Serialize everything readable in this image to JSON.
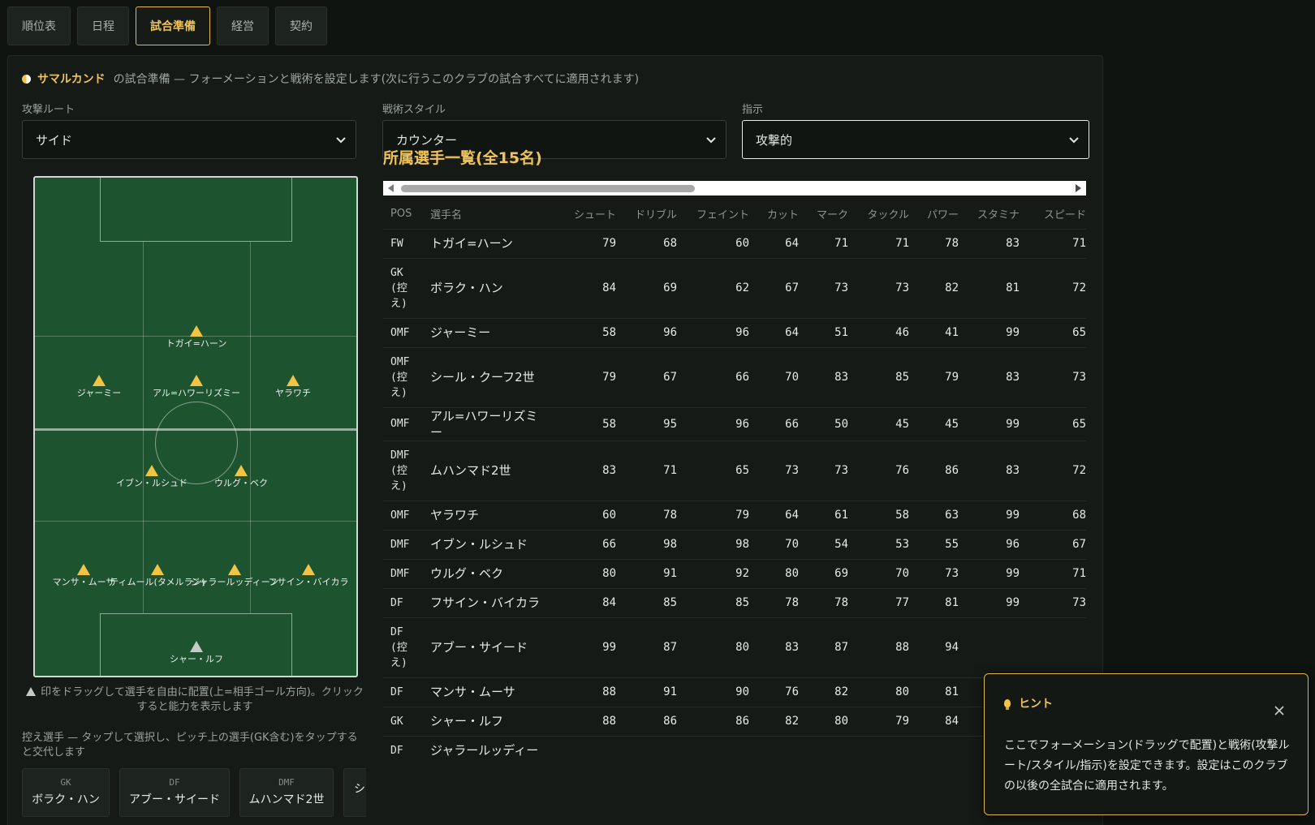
{
  "tabs": [
    {
      "label": "順位表"
    },
    {
      "label": "日程"
    },
    {
      "label": "試合準備",
      "active": true
    },
    {
      "label": "経営"
    },
    {
      "label": "契約"
    }
  ],
  "intro": {
    "club": "サマルカンド",
    "text": "の試合準備 — フォーメーションと戦術を設定します(次に行うこのクラブの試合すべてに適用されます)"
  },
  "selects": {
    "attack_route": {
      "label": "攻撃ルート",
      "value": "サイド"
    },
    "tactic_style": {
      "label": "戦術スタイル",
      "value": "カウンター"
    },
    "instruction": {
      "label": "指示",
      "value": "攻撃的"
    }
  },
  "pitch": {
    "players": [
      {
        "name": "トガイ=ハーン",
        "role": "field"
      },
      {
        "name": "ジャーミー",
        "role": "field"
      },
      {
        "name": "アル=ハワーリズミー",
        "role": "field"
      },
      {
        "name": "ヤラワチ",
        "role": "field"
      },
      {
        "name": "イブン・ルシュド",
        "role": "field"
      },
      {
        "name": "ウルグ・ベク",
        "role": "field"
      },
      {
        "name": "マンサ・ムーサ",
        "role": "field"
      },
      {
        "name": "ティムール(タメルラン)",
        "role": "field"
      },
      {
        "name": "ジャラールッディーン",
        "role": "field"
      },
      {
        "name": "フサイン・バイカラ",
        "role": "field"
      },
      {
        "name": "シャー・ルフ",
        "role": "gk"
      }
    ],
    "note": "印をドラッグして選手を自由に配置(上=相手ゴール方向)。クリックすると能力を表示します"
  },
  "subs": {
    "note": "控え選手 — タップして選択し、ピッチ上の選手(GK含む)をタップすると交代します",
    "cards": [
      {
        "pos": "GK",
        "name": "ボラク・ハン"
      },
      {
        "pos": "DF",
        "name": "アブー・サイード"
      },
      {
        "pos": "DMF",
        "name": "ムハンマド2世"
      },
      {
        "pos": "",
        "name": "シー"
      }
    ]
  },
  "roster": {
    "title": "所属選手一覧(全15名)",
    "headers": [
      "POS",
      "選手名",
      "シュート",
      "ドリブル",
      "フェイント",
      "カット",
      "マーク",
      "タックル",
      "パワー",
      "スタミナ",
      "スピード"
    ],
    "rows": [
      {
        "pos": "FW",
        "name": "トガイ=ハーン",
        "stats": [
          "79",
          "68",
          "60",
          "64",
          "71",
          "71",
          "78",
          "83",
          "71"
        ]
      },
      {
        "pos": "GK\n(控\nえ)",
        "name": "ボラク・ハン",
        "stats": [
          "84",
          "69",
          "62",
          "67",
          "73",
          "73",
          "82",
          "81",
          "72"
        ]
      },
      {
        "pos": "OMF",
        "name": "ジャーミー",
        "stats": [
          "58",
          "96",
          "96",
          "64",
          "51",
          "46",
          "41",
          "99",
          "65"
        ]
      },
      {
        "pos": "OMF\n(控\nえ)",
        "name": "シール・クーフ2世",
        "stats": [
          "79",
          "67",
          "66",
          "70",
          "83",
          "85",
          "79",
          "83",
          "73"
        ]
      },
      {
        "pos": "OMF",
        "name": "アル=ハワーリズミー",
        "stats": [
          "58",
          "95",
          "96",
          "66",
          "50",
          "45",
          "45",
          "99",
          "65"
        ]
      },
      {
        "pos": "DMF\n(控\nえ)",
        "name": "ムハンマド2世",
        "stats": [
          "83",
          "71",
          "65",
          "73",
          "73",
          "76",
          "86",
          "83",
          "72"
        ]
      },
      {
        "pos": "OMF",
        "name": "ヤラワチ",
        "stats": [
          "60",
          "78",
          "79",
          "64",
          "61",
          "58",
          "63",
          "99",
          "68"
        ]
      },
      {
        "pos": "DMF",
        "name": "イブン・ルシュド",
        "stats": [
          "66",
          "98",
          "98",
          "70",
          "54",
          "53",
          "55",
          "96",
          "67"
        ]
      },
      {
        "pos": "DMF",
        "name": "ウルグ・ベク",
        "stats": [
          "80",
          "91",
          "92",
          "80",
          "69",
          "70",
          "73",
          "99",
          "71"
        ]
      },
      {
        "pos": "DF",
        "name": "フサイン・バイカラ",
        "stats": [
          "84",
          "85",
          "85",
          "78",
          "78",
          "77",
          "81",
          "99",
          "73"
        ]
      },
      {
        "pos": "DF\n(控\nえ)",
        "name": "アブー・サイード",
        "stats": [
          "99",
          "87",
          "80",
          "83",
          "87",
          "88",
          "94",
          "",
          ""
        ]
      },
      {
        "pos": "DF",
        "name": "マンサ・ムーサ",
        "stats": [
          "88",
          "91",
          "90",
          "76",
          "82",
          "80",
          "81",
          "",
          ""
        ]
      },
      {
        "pos": "GK",
        "name": "シャー・ルフ",
        "stats": [
          "88",
          "86",
          "86",
          "82",
          "80",
          "79",
          "84",
          "",
          ""
        ]
      },
      {
        "pos": "DF",
        "name": "ジャラールッディー",
        "stats": [
          "",
          "",
          "",
          "",
          "",
          "",
          "",
          "",
          ""
        ]
      }
    ]
  },
  "hint": {
    "title": "ヒント",
    "body": "ここでフォーメーション(ドラッグで配置)と戦術(攻撃ルート/スタイル/指示)を設定できます。設定はこのクラブの以後の全試合に適用されます。"
  },
  "colors": {
    "accent": "#f0c35a",
    "pitch": "#1e5330",
    "background": "#0f1410",
    "panel": "#151a16"
  }
}
